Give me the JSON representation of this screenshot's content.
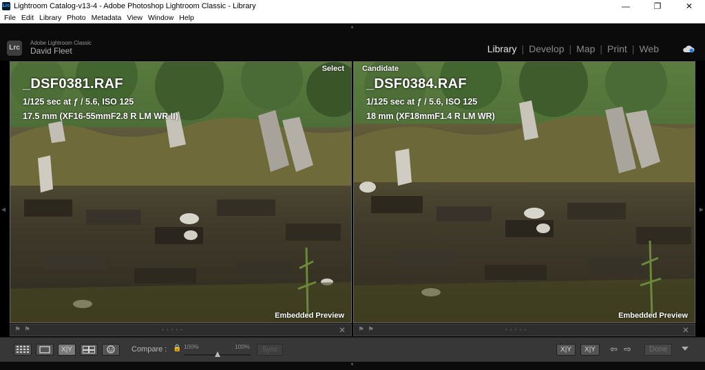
{
  "window": {
    "app_icon": "Lrc",
    "title": "Lightroom Catalog-v13-4 - Adobe Photoshop Lightroom Classic - Library",
    "controls": {
      "minimize": "—",
      "maximize": "❐",
      "close": "✕"
    }
  },
  "menu": [
    "File",
    "Edit",
    "Library",
    "Photo",
    "Metadata",
    "View",
    "Window",
    "Help"
  ],
  "identity": {
    "logo": "Lrc",
    "product": "Adobe Lightroom Classic",
    "user": "David Fleet"
  },
  "modules": {
    "items": [
      "Library",
      "Develop",
      "Map",
      "Print",
      "Web"
    ],
    "active": "Library",
    "separator": "|"
  },
  "compare": {
    "select": {
      "tag": "Select",
      "filename": "_DSF0381.RAF",
      "exposure": "1/125 sec at ƒ / 5.6, ISO 125",
      "lens": "17.5 mm (XF16-55mmF2.8 R LM WR II)",
      "preview": "Embedded Preview"
    },
    "candidate": {
      "tag": "Candidate",
      "filename": "_DSF0384.RAF",
      "exposure": "1/125 sec at ƒ / 5.6, ISO 125",
      "lens": "18 mm (XF18mmF1.4 R LM WR)",
      "preview": "Embedded Preview"
    }
  },
  "pane_footer": {
    "flag_icon": "⚑",
    "close_icon": "✕"
  },
  "toolbar": {
    "grid_icon": "grid-view-icon",
    "loupe_icon": "loupe-view-icon",
    "compare_icon_label": "X|Y",
    "survey_icon": "survey-view-icon",
    "people_icon": "people-view-icon",
    "compare_label": "Compare :",
    "lock_icon": "🔒",
    "zoom_left": "100%",
    "zoom_right": "100%",
    "zoom_level": 0.5,
    "sync_label": "Sync",
    "swap_label": "X|Y",
    "make_select_label": "X|Y",
    "prev_icon": "⇦",
    "next_icon": "⇨",
    "done_label": "Done"
  },
  "colors": {
    "accent": "#e6e6e6",
    "lock": "#c9a22d",
    "panel": "#373737"
  }
}
